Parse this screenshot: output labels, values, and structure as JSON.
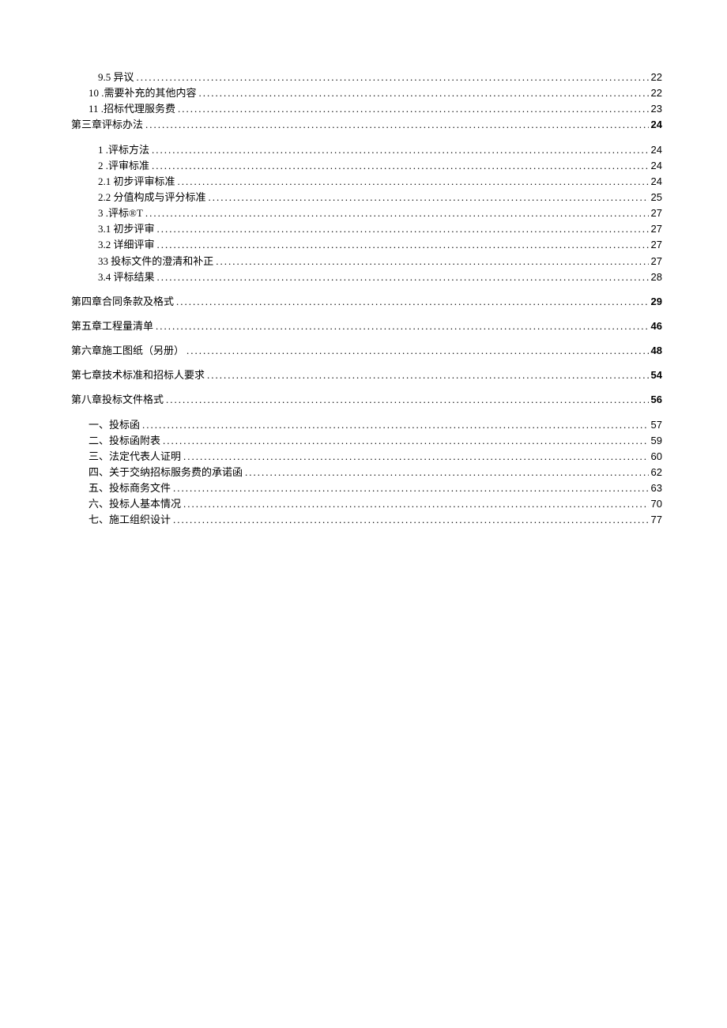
{
  "entries": [
    {
      "indent": 3,
      "label": "9.5    异议",
      "page": "22",
      "bold": false,
      "gap": false
    },
    {
      "indent": 1,
      "label": "10    .需要补充的其他内容",
      "page": "22",
      "bold": false,
      "gap": false
    },
    {
      "indent": 1,
      "label": "11    .招标代理服务费",
      "page": "23",
      "bold": false,
      "gap": false
    },
    {
      "indent": 0,
      "label": "第三章评标办法",
      "page": "24",
      "bold": true,
      "gap": false
    },
    {
      "indent": 2,
      "label": "1    .评标方法",
      "page": "24",
      "bold": false,
      "gap": true
    },
    {
      "indent": 2,
      "label": "2    .评审标准",
      "page": "24",
      "bold": false,
      "gap": false
    },
    {
      "indent": 3,
      "label": "2.1    初步评审标准",
      "page": "24",
      "bold": false,
      "gap": false
    },
    {
      "indent": 3,
      "label": "2.2    分值构成与评分标准",
      "page": "25",
      "bold": false,
      "gap": false
    },
    {
      "indent": 2,
      "label": "3    .评标®T",
      "page": "27",
      "bold": false,
      "gap": false
    },
    {
      "indent": 3,
      "label": "3.1    初步评审",
      "page": "27",
      "bold": false,
      "gap": false
    },
    {
      "indent": 3,
      "label": "3.2    详细评审",
      "page": "27",
      "bold": false,
      "gap": false
    },
    {
      "indent": 3,
      "label": "33 投标文件的澄清和补正",
      "page": "27",
      "bold": false,
      "gap": false
    },
    {
      "indent": 3,
      "label": "3.4    评标结果",
      "page": "28",
      "bold": false,
      "gap": false
    },
    {
      "indent": 0,
      "label": "第四章合同条款及格式",
      "page": "29",
      "bold": true,
      "gap": true
    },
    {
      "indent": 0,
      "label": "第五章工程量清单",
      "page": "46",
      "bold": true,
      "gap": true
    },
    {
      "indent": 0,
      "label": "第六章施工图纸（另册） ",
      "page": "48",
      "bold": true,
      "gap": true
    },
    {
      "indent": 0,
      "label": "第七章技术标准和招标人要求",
      "page": "54",
      "bold": true,
      "gap": true
    },
    {
      "indent": 0,
      "label": "第八章投标文件格式",
      "page": "56",
      "bold": true,
      "gap": true
    },
    {
      "indent": 1,
      "label": "一、投标函",
      "page": "57",
      "bold": false,
      "gap": true
    },
    {
      "indent": 1,
      "label": "二、投标函附表",
      "page": "59",
      "bold": false,
      "gap": false
    },
    {
      "indent": 1,
      "label": "三、法定代表人证明",
      "page": "60",
      "bold": false,
      "gap": false
    },
    {
      "indent": 1,
      "label": "四、关于交纳招标服务费的承诺函",
      "page": "62",
      "bold": false,
      "gap": false
    },
    {
      "indent": 1,
      "label": "五、投标商务文件",
      "page": "63",
      "bold": false,
      "gap": false
    },
    {
      "indent": 1,
      "label": "六、投标人基本情况",
      "page": "70",
      "bold": false,
      "gap": false
    },
    {
      "indent": 1,
      "label": "七、施工组织设计",
      "page": "77",
      "bold": false,
      "gap": false
    }
  ]
}
